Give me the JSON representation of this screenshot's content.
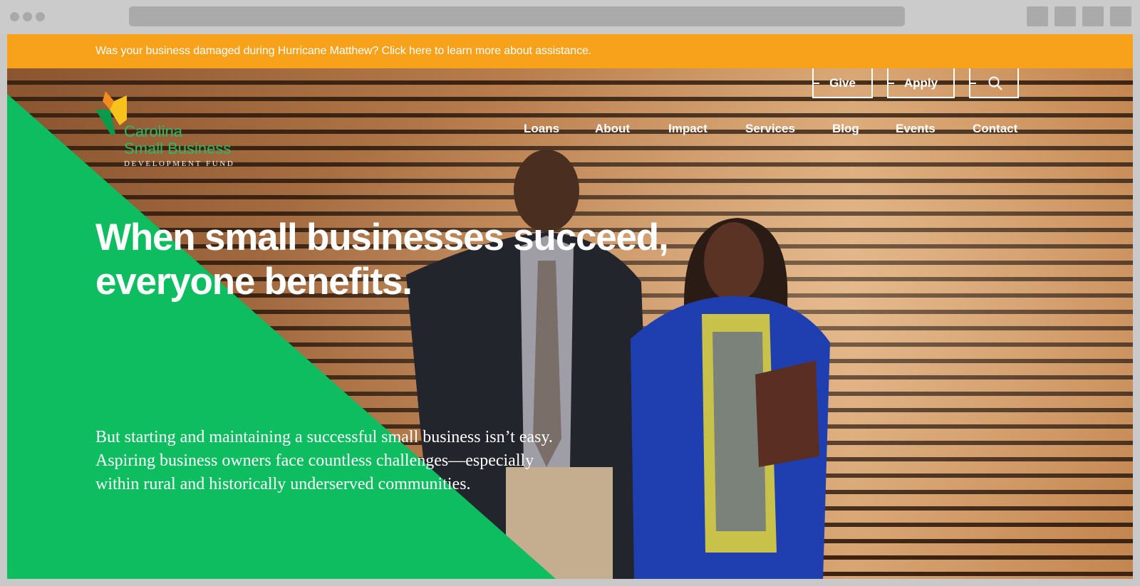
{
  "banner": {
    "text": "Was your business damaged during Hurricane Matthew? Click here to learn more about assistance."
  },
  "logo": {
    "line1": "Carolina",
    "line2": "Small Business",
    "line3": "DEVELOPMENT FUND"
  },
  "utility_nav": {
    "give_label": "Give",
    "apply_label": "Apply",
    "search_icon": "search-icon"
  },
  "main_nav": {
    "items": [
      "Loans",
      "About",
      "Impact",
      "Services",
      "Blog",
      "Events",
      "Contact"
    ]
  },
  "hero": {
    "headline_line1": "When small businesses succeed,",
    "headline_line2": "everyone benefits.",
    "body": "But starting and maintaining a successful small business isn’t easy. Aspiring business owners face countless challenges—especially within rural and historically underserved communities."
  },
  "colors": {
    "banner": "#f8a21c",
    "brand_green": "#0dbd5f",
    "logo_yellow": "#f6c21b",
    "logo_orange": "#f28c1e",
    "text_white": "#ffffff"
  }
}
